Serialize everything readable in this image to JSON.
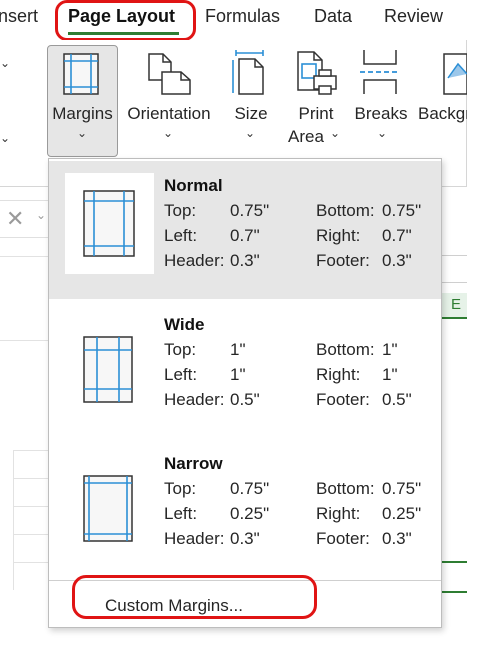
{
  "tabs": [
    {
      "label": "nsert"
    },
    {
      "label": "Page Layout",
      "active": true
    },
    {
      "label": "Formulas"
    },
    {
      "label": "Data"
    },
    {
      "label": "Review"
    }
  ],
  "ribbon": {
    "margins": "Margins",
    "orientation": "Orientation",
    "size": "Size",
    "print_area_line1": "Print",
    "print_area_line2": "Area",
    "breaks": "Breaks",
    "background": "Backgr"
  },
  "sheet": {
    "column_e": "E"
  },
  "margins_menu": {
    "presets": [
      {
        "name": "Normal",
        "top_label": "Top:",
        "top": "0.75\"",
        "left_label": "Left:",
        "left": "0.7\"",
        "header_label": "Header:",
        "header": "0.3\"",
        "bottom_label": "Bottom:",
        "bottom": "0.75\"",
        "right_label": "Right:",
        "right": "0.7\"",
        "footer_label": "Footer:",
        "footer": "0.3\""
      },
      {
        "name": "Wide",
        "top_label": "Top:",
        "top": "1\"",
        "left_label": "Left:",
        "left": "1\"",
        "header_label": "Header:",
        "header": "0.5\"",
        "bottom_label": "Bottom:",
        "bottom": "1\"",
        "right_label": "Right:",
        "right": "1\"",
        "footer_label": "Footer:",
        "footer": "0.5\""
      },
      {
        "name": "Narrow",
        "top_label": "Top:",
        "top": "0.75\"",
        "left_label": "Left:",
        "left": "0.25\"",
        "header_label": "Header:",
        "header": "0.3\"",
        "bottom_label": "Bottom:",
        "bottom": "0.75\"",
        "right_label": "Right:",
        "right": "0.25\"",
        "footer_label": "Footer:",
        "footer": "0.3\""
      }
    ],
    "custom": "Custom Margins..."
  },
  "colors": {
    "accent_green": "#2e7d32",
    "annotation_red": "#e01414",
    "icon_blue": "#2b8fd6",
    "hover_gray": "#e6e6e6"
  }
}
